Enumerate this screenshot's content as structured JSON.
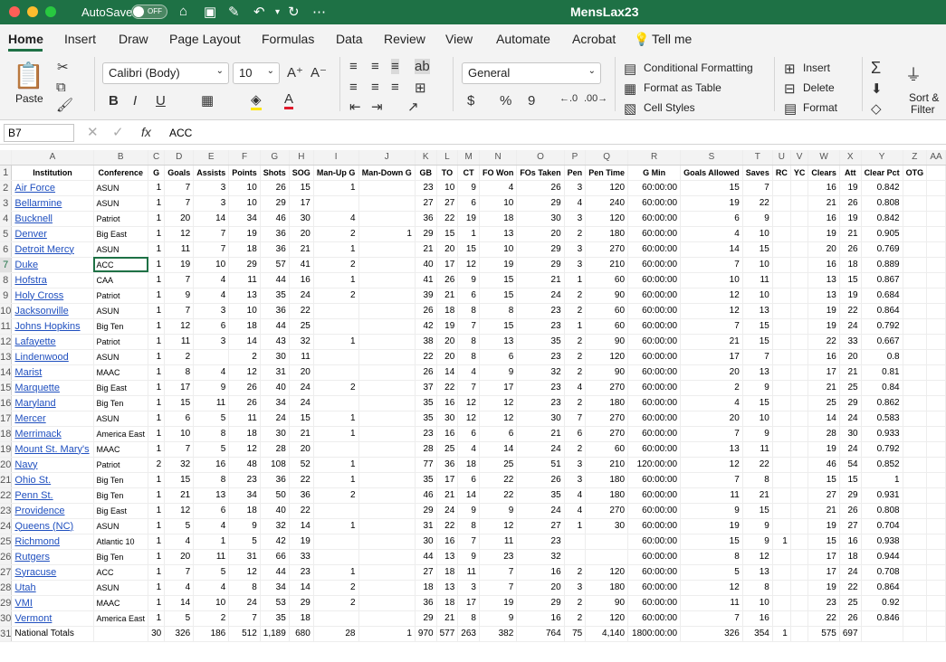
{
  "window": {
    "autosave_label": "AutoSave",
    "autosave_state": "OFF",
    "doc_title": "MensLax23",
    "colors": {
      "titlebar": "#1e7145",
      "close": "#ff5f57",
      "minimize": "#febc2e",
      "zoom": "#28c840"
    }
  },
  "menu": [
    "Home",
    "Insert",
    "Draw",
    "Page Layout",
    "Formulas",
    "Data",
    "Review",
    "View",
    "Automate",
    "Acrobat",
    "Tell me"
  ],
  "ribbon": {
    "paste": "Paste",
    "font_name": "Calibri (Body)",
    "font_size": "10",
    "bold": "B",
    "italic": "I",
    "underline": "U",
    "number_format": "General",
    "currency": "$",
    "percent": "%",
    "comma": "9",
    "conditional_formatting": "Conditional Formatting",
    "format_as_table": "Format as Table",
    "cell_styles": "Cell Styles",
    "insert": "Insert",
    "delete": "Delete",
    "format": "Format",
    "sort_filter_1": "Sort &",
    "sort_filter_2": "Filter"
  },
  "formula_bar": {
    "cell_ref": "B7",
    "fx": "fx",
    "value": "ACC"
  },
  "columns": [
    "A",
    "B",
    "C",
    "D",
    "E",
    "F",
    "G",
    "H",
    "I",
    "J",
    "K",
    "L",
    "M",
    "N",
    "O",
    "P",
    "Q",
    "R",
    "S",
    "T",
    "U",
    "V",
    "W",
    "X",
    "Y",
    "Z",
    "AA"
  ],
  "headers": [
    "Institution",
    "Conference",
    "G",
    "Goals",
    "Assists",
    "Points",
    "Shots",
    "SOG",
    "Man-Up G",
    "Man-Down G",
    "GB",
    "TO",
    "CT",
    "FO Won",
    "FOs Taken",
    "Pen",
    "Pen Time",
    "G Min",
    "Goals Allowed",
    "Saves",
    "RC",
    "YC",
    "Clears",
    "Att",
    "Clear Pct",
    "OTG",
    ""
  ],
  "rows": [
    [
      "Air Force",
      "ASUN",
      "1",
      "7",
      "3",
      "10",
      "26",
      "15",
      "1",
      "",
      "23",
      "10",
      "9",
      "4",
      "26",
      "3",
      "120",
      "60:00:00",
      "15",
      "7",
      "",
      "",
      "16",
      "19",
      "0.842",
      "",
      ""
    ],
    [
      "Bellarmine",
      "ASUN",
      "1",
      "7",
      "3",
      "10",
      "29",
      "17",
      "",
      "",
      "27",
      "27",
      "6",
      "10",
      "29",
      "4",
      "240",
      "60:00:00",
      "19",
      "22",
      "",
      "",
      "21",
      "26",
      "0.808",
      "",
      ""
    ],
    [
      "Bucknell",
      "Patriot",
      "1",
      "20",
      "14",
      "34",
      "46",
      "30",
      "4",
      "",
      "36",
      "22",
      "19",
      "18",
      "30",
      "3",
      "120",
      "60:00:00",
      "6",
      "9",
      "",
      "",
      "16",
      "19",
      "0.842",
      "",
      ""
    ],
    [
      "Denver",
      "Big East",
      "1",
      "12",
      "7",
      "19",
      "36",
      "20",
      "2",
      "1",
      "29",
      "15",
      "1",
      "13",
      "20",
      "2",
      "180",
      "60:00:00",
      "4",
      "10",
      "",
      "",
      "19",
      "21",
      "0.905",
      "",
      ""
    ],
    [
      "Detroit Mercy",
      "ASUN",
      "1",
      "11",
      "7",
      "18",
      "36",
      "21",
      "1",
      "",
      "21",
      "20",
      "15",
      "10",
      "29",
      "3",
      "270",
      "60:00:00",
      "14",
      "15",
      "",
      "",
      "20",
      "26",
      "0.769",
      "",
      ""
    ],
    [
      "Duke",
      "ACC",
      "1",
      "19",
      "10",
      "29",
      "57",
      "41",
      "2",
      "",
      "40",
      "17",
      "12",
      "19",
      "29",
      "3",
      "210",
      "60:00:00",
      "7",
      "10",
      "",
      "",
      "16",
      "18",
      "0.889",
      "",
      ""
    ],
    [
      "Hofstra",
      "CAA",
      "1",
      "7",
      "4",
      "11",
      "44",
      "16",
      "1",
      "",
      "41",
      "26",
      "9",
      "15",
      "21",
      "1",
      "60",
      "60:00:00",
      "10",
      "11",
      "",
      "",
      "13",
      "15",
      "0.867",
      "",
      ""
    ],
    [
      "Holy Cross",
      "Patriot",
      "1",
      "9",
      "4",
      "13",
      "35",
      "24",
      "2",
      "",
      "39",
      "21",
      "6",
      "15",
      "24",
      "2",
      "90",
      "60:00:00",
      "12",
      "10",
      "",
      "",
      "13",
      "19",
      "0.684",
      "",
      ""
    ],
    [
      "Jacksonville",
      "ASUN",
      "1",
      "7",
      "3",
      "10",
      "36",
      "22",
      "",
      "",
      "26",
      "18",
      "8",
      "8",
      "23",
      "2",
      "60",
      "60:00:00",
      "12",
      "13",
      "",
      "",
      "19",
      "22",
      "0.864",
      "",
      ""
    ],
    [
      "Johns Hopkins",
      "Big Ten",
      "1",
      "12",
      "6",
      "18",
      "44",
      "25",
      "",
      "",
      "42",
      "19",
      "7",
      "15",
      "23",
      "1",
      "60",
      "60:00:00",
      "7",
      "15",
      "",
      "",
      "19",
      "24",
      "0.792",
      "",
      ""
    ],
    [
      "Lafayette",
      "Patriot",
      "1",
      "11",
      "3",
      "14",
      "43",
      "32",
      "1",
      "",
      "38",
      "20",
      "8",
      "13",
      "35",
      "2",
      "90",
      "60:00:00",
      "21",
      "15",
      "",
      "",
      "22",
      "33",
      "0.667",
      "",
      ""
    ],
    [
      "Lindenwood",
      "ASUN",
      "1",
      "2",
      "",
      "2",
      "30",
      "11",
      "",
      "",
      "22",
      "20",
      "8",
      "6",
      "23",
      "2",
      "120",
      "60:00:00",
      "17",
      "7",
      "",
      "",
      "16",
      "20",
      "0.8",
      "",
      ""
    ],
    [
      "Marist",
      "MAAC",
      "1",
      "8",
      "4",
      "12",
      "31",
      "20",
      "",
      "",
      "26",
      "14",
      "4",
      "9",
      "32",
      "2",
      "90",
      "60:00:00",
      "20",
      "13",
      "",
      "",
      "17",
      "21",
      "0.81",
      "",
      ""
    ],
    [
      "Marquette",
      "Big East",
      "1",
      "17",
      "9",
      "26",
      "40",
      "24",
      "2",
      "",
      "37",
      "22",
      "7",
      "17",
      "23",
      "4",
      "270",
      "60:00:00",
      "2",
      "9",
      "",
      "",
      "21",
      "25",
      "0.84",
      "",
      ""
    ],
    [
      "Maryland",
      "Big Ten",
      "1",
      "15",
      "11",
      "26",
      "34",
      "24",
      "",
      "",
      "35",
      "16",
      "12",
      "12",
      "23",
      "2",
      "180",
      "60:00:00",
      "4",
      "15",
      "",
      "",
      "25",
      "29",
      "0.862",
      "",
      ""
    ],
    [
      "Mercer",
      "ASUN",
      "1",
      "6",
      "5",
      "11",
      "24",
      "15",
      "1",
      "",
      "35",
      "30",
      "12",
      "12",
      "30",
      "7",
      "270",
      "60:00:00",
      "20",
      "10",
      "",
      "",
      "14",
      "24",
      "0.583",
      "",
      ""
    ],
    [
      "Merrimack",
      "America East",
      "1",
      "10",
      "8",
      "18",
      "30",
      "21",
      "1",
      "",
      "23",
      "16",
      "6",
      "6",
      "21",
      "6",
      "270",
      "60:00:00",
      "7",
      "9",
      "",
      "",
      "28",
      "30",
      "0.933",
      "",
      ""
    ],
    [
      "Mount St. Mary's",
      "MAAC",
      "1",
      "7",
      "5",
      "12",
      "28",
      "20",
      "",
      "",
      "28",
      "25",
      "4",
      "14",
      "24",
      "2",
      "60",
      "60:00:00",
      "13",
      "11",
      "",
      "",
      "19",
      "24",
      "0.792",
      "",
      ""
    ],
    [
      "Navy",
      "Patriot",
      "2",
      "32",
      "16",
      "48",
      "108",
      "52",
      "1",
      "",
      "77",
      "36",
      "18",
      "25",
      "51",
      "3",
      "210",
      "120:00:00",
      "12",
      "22",
      "",
      "",
      "46",
      "54",
      "0.852",
      "",
      ""
    ],
    [
      "Ohio St.",
      "Big Ten",
      "1",
      "15",
      "8",
      "23",
      "36",
      "22",
      "1",
      "",
      "35",
      "17",
      "6",
      "22",
      "26",
      "3",
      "180",
      "60:00:00",
      "7",
      "8",
      "",
      "",
      "15",
      "15",
      "1",
      "",
      ""
    ],
    [
      "Penn St.",
      "Big Ten",
      "1",
      "21",
      "13",
      "34",
      "50",
      "36",
      "2",
      "",
      "46",
      "21",
      "14",
      "22",
      "35",
      "4",
      "180",
      "60:00:00",
      "11",
      "21",
      "",
      "",
      "27",
      "29",
      "0.931",
      "",
      ""
    ],
    [
      "Providence",
      "Big East",
      "1",
      "12",
      "6",
      "18",
      "40",
      "22",
      "",
      "",
      "29",
      "24",
      "9",
      "9",
      "24",
      "4",
      "270",
      "60:00:00",
      "9",
      "15",
      "",
      "",
      "21",
      "26",
      "0.808",
      "",
      ""
    ],
    [
      "Queens (NC)",
      "ASUN",
      "1",
      "5",
      "4",
      "9",
      "32",
      "14",
      "1",
      "",
      "31",
      "22",
      "8",
      "12",
      "27",
      "1",
      "30",
      "60:00:00",
      "19",
      "9",
      "",
      "",
      "19",
      "27",
      "0.704",
      "",
      ""
    ],
    [
      "Richmond",
      "Atlantic 10",
      "1",
      "4",
      "1",
      "5",
      "42",
      "19",
      "",
      "",
      "30",
      "16",
      "7",
      "11",
      "23",
      "",
      "",
      "60:00:00",
      "15",
      "9",
      "1",
      "",
      "15",
      "16",
      "0.938",
      "",
      ""
    ],
    [
      "Rutgers",
      "Big Ten",
      "1",
      "20",
      "11",
      "31",
      "66",
      "33",
      "",
      "",
      "44",
      "13",
      "9",
      "23",
      "32",
      "",
      "",
      "60:00:00",
      "8",
      "12",
      "",
      "",
      "17",
      "18",
      "0.944",
      "",
      ""
    ],
    [
      "Syracuse",
      "ACC",
      "1",
      "7",
      "5",
      "12",
      "44",
      "23",
      "1",
      "",
      "27",
      "18",
      "11",
      "7",
      "16",
      "2",
      "120",
      "60:00:00",
      "5",
      "13",
      "",
      "",
      "17",
      "24",
      "0.708",
      "",
      ""
    ],
    [
      "Utah",
      "ASUN",
      "1",
      "4",
      "4",
      "8",
      "34",
      "14",
      "2",
      "",
      "18",
      "13",
      "3",
      "7",
      "20",
      "3",
      "180",
      "60:00:00",
      "12",
      "8",
      "",
      "",
      "19",
      "22",
      "0.864",
      "",
      ""
    ],
    [
      "VMI",
      "MAAC",
      "1",
      "14",
      "10",
      "24",
      "53",
      "29",
      "2",
      "",
      "36",
      "18",
      "17",
      "19",
      "29",
      "2",
      "90",
      "60:00:00",
      "11",
      "10",
      "",
      "",
      "23",
      "25",
      "0.92",
      "",
      ""
    ],
    [
      "Vermont",
      "America East",
      "1",
      "5",
      "2",
      "7",
      "35",
      "18",
      "",
      "",
      "29",
      "21",
      "8",
      "9",
      "16",
      "2",
      "120",
      "60:00:00",
      "7",
      "16",
      "",
      "",
      "22",
      "26",
      "0.846",
      "",
      ""
    ],
    [
      "National Totals",
      "",
      "30",
      "326",
      "186",
      "512",
      "1,189",
      "680",
      "28",
      "1",
      "970",
      "577",
      "263",
      "382",
      "764",
      "75",
      "4,140",
      "1800:00:00",
      "326",
      "354",
      "1",
      "",
      "575",
      "697",
      "",
      "",
      ""
    ]
  ]
}
